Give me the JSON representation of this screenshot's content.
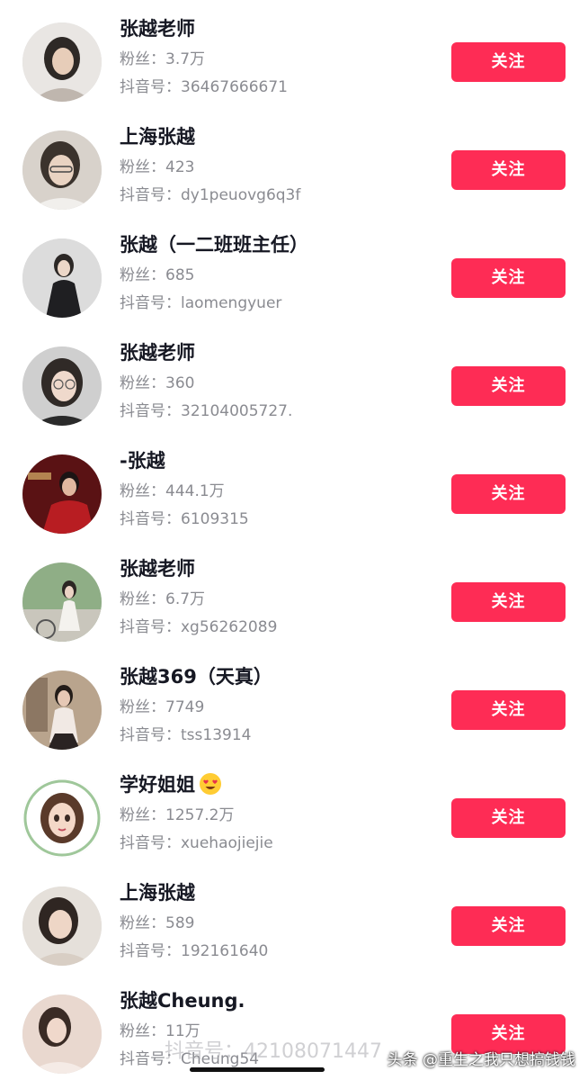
{
  "users": [
    {
      "name": "张越老师",
      "fans": "粉丝：3.7万",
      "douyin_id": "抖音号：36467666671",
      "follow_label": "关注"
    },
    {
      "name": "上海张越",
      "fans": "粉丝：423",
      "douyin_id": "抖音号：dy1peuovg6q3f",
      "follow_label": "关注"
    },
    {
      "name": "张越（一二班班主任）",
      "fans": "粉丝：685",
      "douyin_id": "抖音号：laomengyuer",
      "follow_label": "关注"
    },
    {
      "name": "张越老师",
      "fans": "粉丝：360",
      "douyin_id": "抖音号：32104005727.",
      "follow_label": "关注"
    },
    {
      "name": "-张越",
      "fans": "粉丝：444.1万",
      "douyin_id": "抖音号：6109315",
      "follow_label": "关注"
    },
    {
      "name": "张越老师",
      "fans": "粉丝：6.7万",
      "douyin_id": "抖音号：xg56262089",
      "follow_label": "关注"
    },
    {
      "name": "张越369（天真）",
      "fans": "粉丝：7749",
      "douyin_id": "抖音号：tss13914",
      "follow_label": "关注"
    },
    {
      "name": "学好姐姐",
      "fans": "粉丝：1257.2万",
      "douyin_id": "抖音号：xuehaojiejie",
      "follow_label": "关注",
      "name_emoji": "heart-eyes-emoji-icon"
    },
    {
      "name": "上海张越",
      "fans": "粉丝：589",
      "douyin_id": "抖音号：192161640",
      "follow_label": "关注"
    },
    {
      "name": "张越Cheung.",
      "fans": "粉丝：11万",
      "douyin_id": "抖音号：Cheung54",
      "follow_label": "关注"
    }
  ],
  "overlay": {
    "watermark": "抖音号：42108071447",
    "credit": "头条 @重生之我只想搞钱钱"
  },
  "colors": {
    "follow_button": "#fe2c55",
    "secondary_text": "#8a8b91",
    "primary_text": "#161823"
  }
}
